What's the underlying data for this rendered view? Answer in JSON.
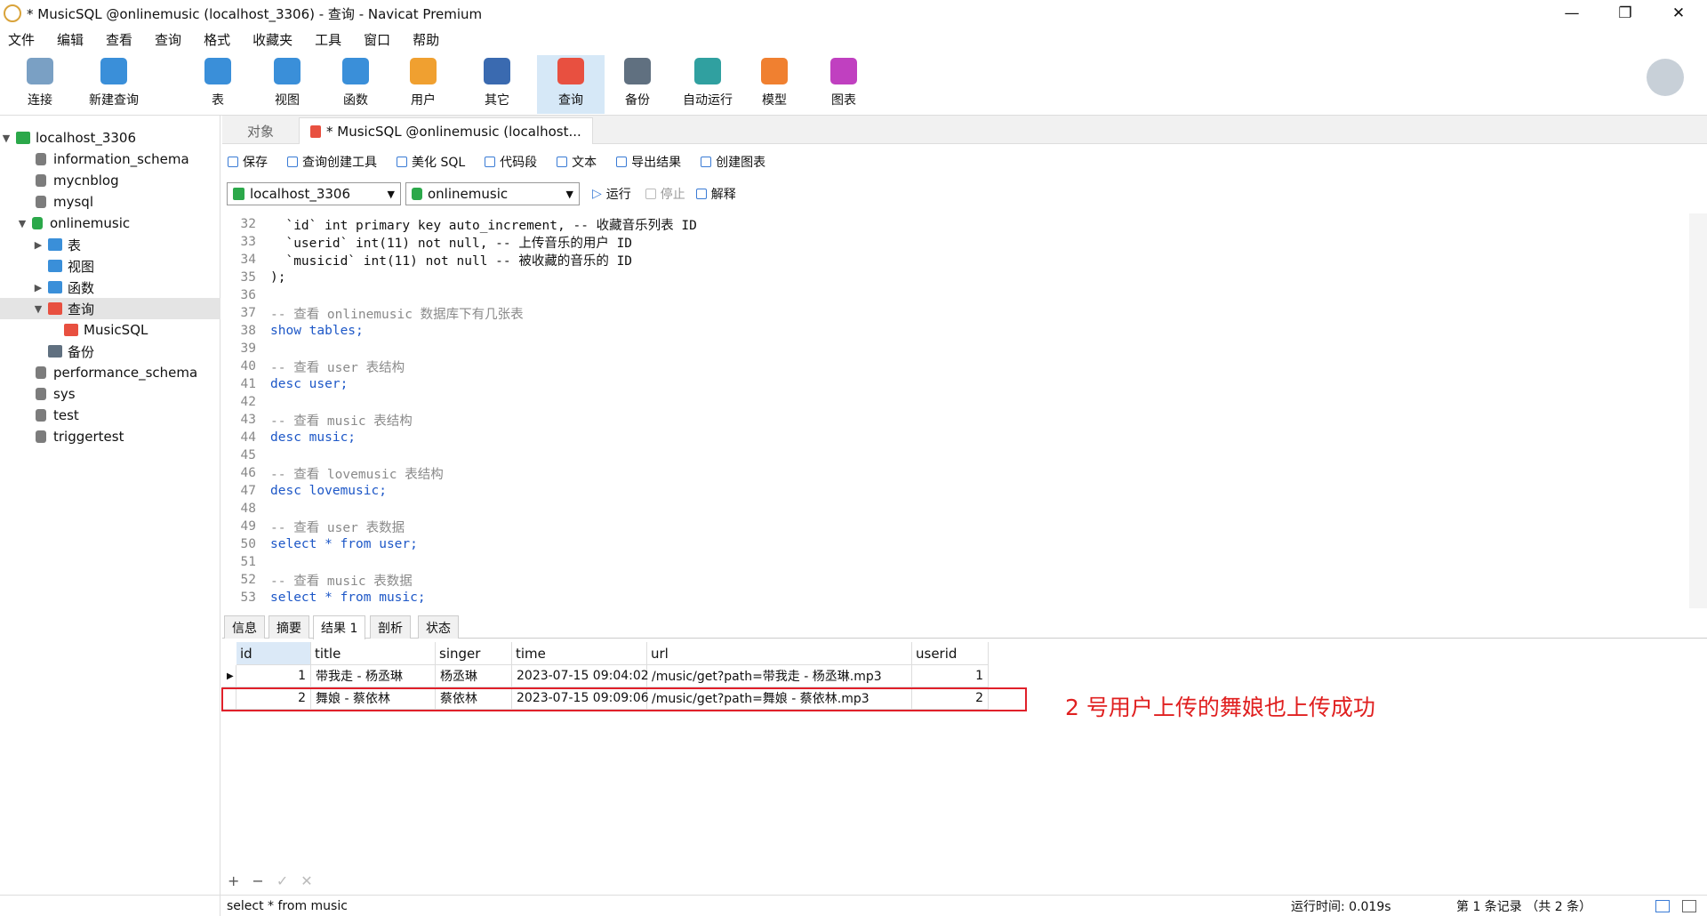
{
  "window": {
    "title": "* MusicSQL @onlinemusic (localhost_3306) - 查询 - Navicat Premium"
  },
  "menu": [
    "文件",
    "编辑",
    "查看",
    "查询",
    "格式",
    "收藏夹",
    "工具",
    "窗口",
    "帮助"
  ],
  "toolbar": {
    "items": [
      {
        "label": "连接",
        "icon": "connect-icon",
        "color": "#7aa0c4"
      },
      {
        "label": "新建查询",
        "icon": "new-query-icon",
        "color": "#3a8fd9"
      },
      {
        "label": "表",
        "icon": "table-icon",
        "color": "#3a8fd9"
      },
      {
        "label": "视图",
        "icon": "view-icon",
        "color": "#3a8fd9"
      },
      {
        "label": "函数",
        "icon": "function-icon",
        "color": "#3a8fd9"
      },
      {
        "label": "用户",
        "icon": "user-icon",
        "color": "#f0a030"
      },
      {
        "label": "其它",
        "icon": "tools-icon",
        "color": "#3a6ab0"
      },
      {
        "label": "查询",
        "icon": "query-icon",
        "color": "#e85040"
      },
      {
        "label": "备份",
        "icon": "backup-icon",
        "color": "#607080"
      },
      {
        "label": "自动运行",
        "icon": "robot-icon",
        "color": "#30a0a0"
      },
      {
        "label": "模型",
        "icon": "model-icon",
        "color": "#f08030"
      },
      {
        "label": "图表",
        "icon": "chart-icon",
        "color": "#c040c0"
      }
    ]
  },
  "sidebar": {
    "items": [
      {
        "label": "localhost_3306"
      },
      {
        "label": "information_schema"
      },
      {
        "label": "mycnblog"
      },
      {
        "label": "mysql"
      },
      {
        "label": "onlinemusic"
      },
      {
        "label": "表"
      },
      {
        "label": "视图"
      },
      {
        "label": "函数"
      },
      {
        "label": "查询"
      },
      {
        "label": "MusicSQL"
      },
      {
        "label": "备份"
      },
      {
        "label": "performance_schema"
      },
      {
        "label": "sys"
      },
      {
        "label": "test"
      },
      {
        "label": "triggertest"
      }
    ]
  },
  "tabs": {
    "objects": "对象",
    "query": "* MusicSQL @onlinemusic (localhost..."
  },
  "querybar": {
    "save": "保存",
    "builder": "查询创建工具",
    "beautify": "美化 SQL",
    "snippet": "代码段",
    "text": "文本",
    "export": "导出结果",
    "chart": "创建图表"
  },
  "selectors": {
    "connection": "localhost_3306",
    "database": "onlinemusic",
    "run": "运行",
    "stop": "停止",
    "explain": "解释"
  },
  "editor": {
    "lines": [
      {
        "n": "32",
        "t": "  `id` int primary key auto_increment, -- 收藏音乐列表 ID"
      },
      {
        "n": "33",
        "t": "  `userid` int(11) not null, -- 上传音乐的用户 ID"
      },
      {
        "n": "34",
        "t": "  `musicid` int(11) not null -- 被收藏的音乐的 ID"
      },
      {
        "n": "35",
        "t": ");"
      },
      {
        "n": "36",
        "t": ""
      },
      {
        "n": "37",
        "t": "-- 查看 onlinemusic 数据库下有几张表"
      },
      {
        "n": "38",
        "t": "show tables;"
      },
      {
        "n": "39",
        "t": ""
      },
      {
        "n": "40",
        "t": "-- 查看 user 表结构"
      },
      {
        "n": "41",
        "t": "desc user;"
      },
      {
        "n": "42",
        "t": ""
      },
      {
        "n": "43",
        "t": "-- 查看 music 表结构"
      },
      {
        "n": "44",
        "t": "desc music;"
      },
      {
        "n": "45",
        "t": ""
      },
      {
        "n": "46",
        "t": "-- 查看 lovemusic 表结构"
      },
      {
        "n": "47",
        "t": "desc lovemusic;"
      },
      {
        "n": "48",
        "t": ""
      },
      {
        "n": "49",
        "t": "-- 查看 user 表数据"
      },
      {
        "n": "50",
        "t": "select * from user;"
      },
      {
        "n": "51",
        "t": ""
      },
      {
        "n": "52",
        "t": "-- 查看 music 表数据"
      },
      {
        "n": "53",
        "t": "select * from music;"
      }
    ]
  },
  "result_tabs": [
    "信息",
    "摘要",
    "结果 1",
    "剖析",
    "状态"
  ],
  "grid": {
    "columns": [
      "id",
      "title",
      "singer",
      "time",
      "url",
      "userid"
    ],
    "rows": [
      [
        "1",
        "带我走 - 杨丞琳",
        "杨丞琳",
        "2023-07-15 09:04:02",
        "/music/get?path=带我走 - 杨丞琳.mp3",
        "1"
      ],
      [
        "2",
        "舞娘 - 蔡依林",
        "蔡依林",
        "2023-07-15 09:09:06",
        "/music/get?path=舞娘 - 蔡依林.mp3",
        "2"
      ]
    ]
  },
  "annotation": "2 号用户上传的舞娘也上传成功",
  "gridfoot": [
    "+",
    "−",
    "✓",
    "✕"
  ],
  "status": {
    "sql": "select * from music",
    "time": "运行时间: 0.019s",
    "records": "第 1 条记录 （共 2 条）"
  }
}
